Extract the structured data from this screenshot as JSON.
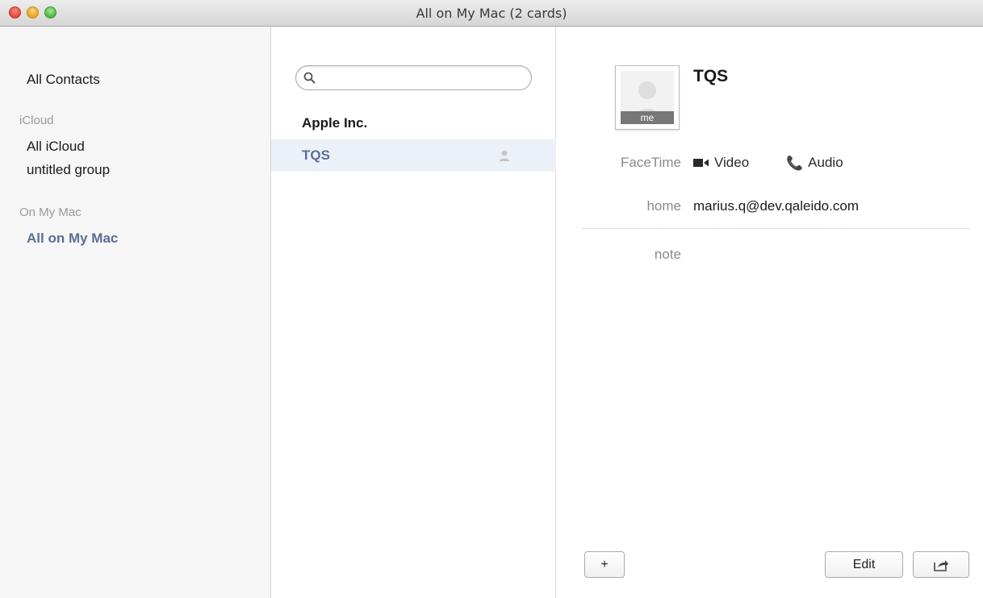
{
  "window": {
    "title": "All on My Mac (2 cards)"
  },
  "sidebar": {
    "all_contacts": "All Contacts",
    "icloud_header": "iCloud",
    "icloud_items": [
      "All iCloud",
      "untitled group"
    ],
    "onmymac_header": "On My Mac",
    "onmymac_items": [
      "All on My Mac"
    ],
    "selected": "All on My Mac"
  },
  "list": {
    "search_value": "",
    "search_placeholder": "",
    "rows": [
      {
        "label": "Apple Inc.",
        "selected": false
      },
      {
        "label": "TQS",
        "selected": true,
        "icon": "person-icon"
      }
    ]
  },
  "detail": {
    "name": "TQS",
    "photo_badge": "me",
    "facetime_label": "FaceTime",
    "video_label": "Video",
    "audio_label": "Audio",
    "home_label": "home",
    "home_value": "marius.q@dev.qaleido.com",
    "note_label": "note",
    "add_button": "+",
    "edit_button": "Edit",
    "share_icon": "share-icon"
  },
  "colors": {
    "selected_text": "#5a6f94",
    "selected_row_bg": "#ecf0f7",
    "sidebar_bg": "#f6f6f6"
  }
}
